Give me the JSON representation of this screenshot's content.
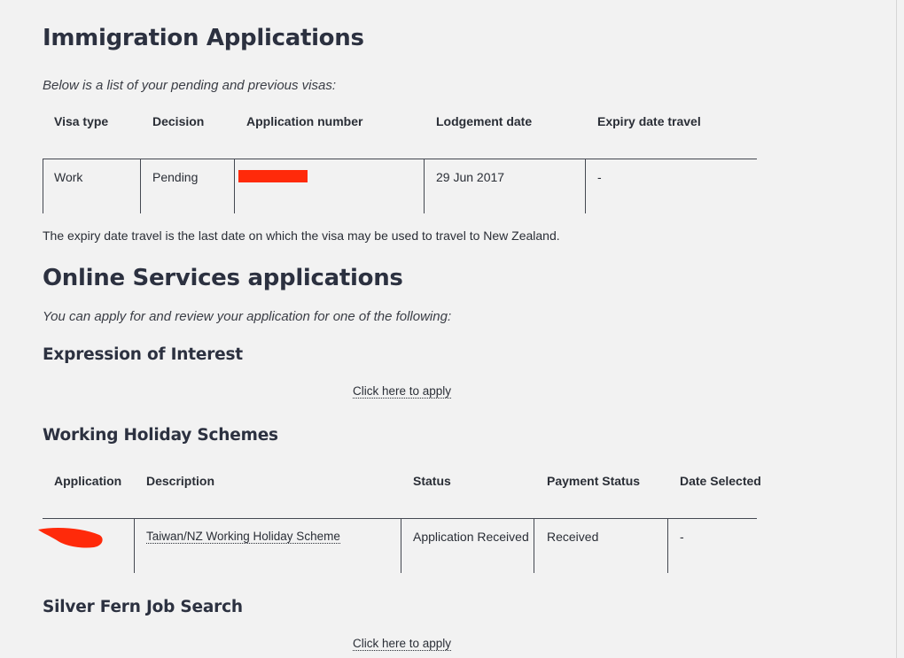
{
  "immigration": {
    "title": "Immigration Applications",
    "intro": "Below is a list of your pending and previous visas:",
    "columns": [
      "Visa type",
      "Decision",
      "Application number",
      "Lodgement date",
      "Expiry date travel"
    ],
    "rows": [
      {
        "visa_type": "Work",
        "decision": "Pending",
        "application_number": "",
        "lodgement_date": "29 Jun 2017",
        "expiry_date_travel": "-"
      }
    ],
    "note": "The expiry date travel is the last date on which the visa may be used to travel to New Zealand."
  },
  "online_services": {
    "title": "Online Services applications",
    "intro": "You can apply for and review your application for one of the following:",
    "eoi": {
      "title": "Expression of Interest",
      "link": "Click here to apply"
    },
    "whs": {
      "title": "Working Holiday Schemes",
      "columns": [
        "Application",
        "Description",
        "Status",
        "Payment Status",
        "Date Selected"
      ],
      "rows": [
        {
          "application": "",
          "description": "Taiwan/NZ Working Holiday Scheme",
          "status": "Application Received",
          "payment_status": "Received",
          "date_selected": "-"
        }
      ]
    },
    "silver_fern": {
      "title": "Silver Fern Job Search",
      "link": "Click here to apply"
    }
  },
  "colors": {
    "background": "#f2f2f2",
    "heading": "#2c3140",
    "redaction": "#ff2a0a"
  }
}
